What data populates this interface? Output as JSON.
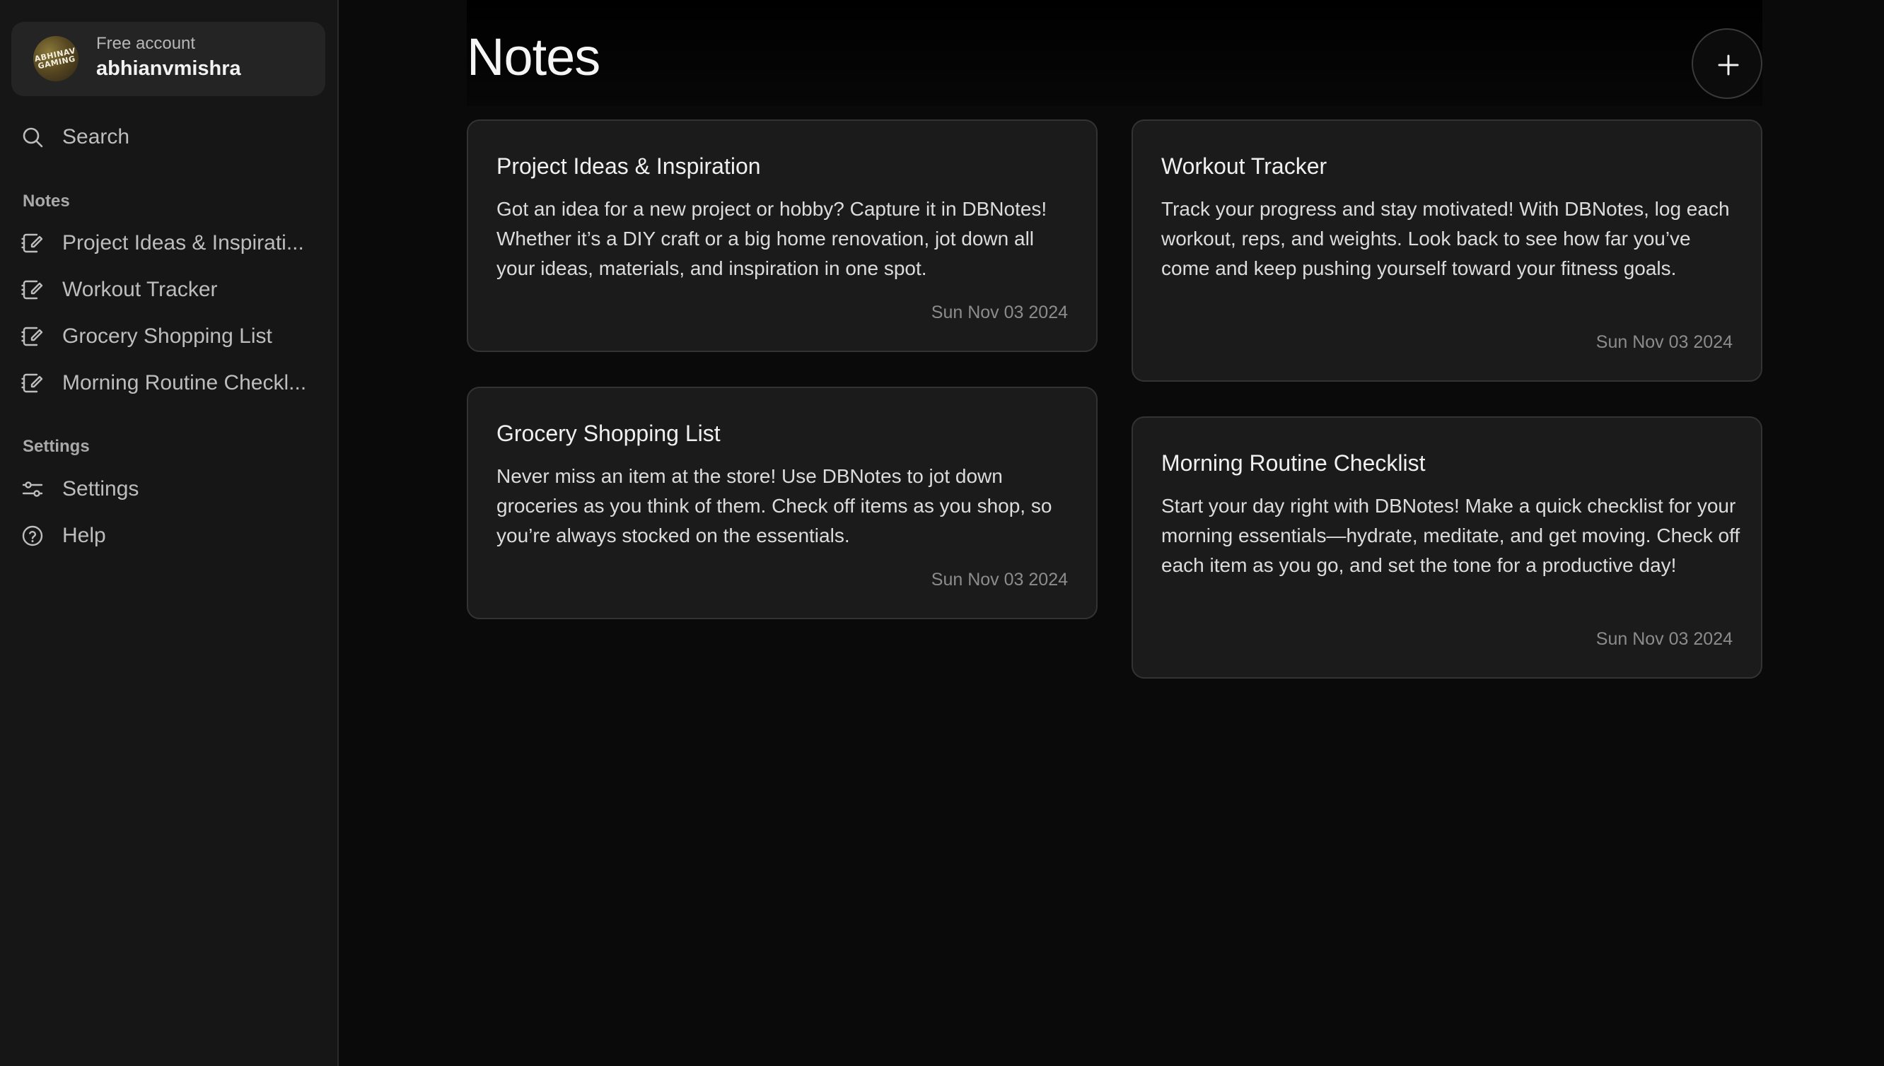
{
  "account": {
    "plan": "Free account",
    "username": "abhianvmishra",
    "avatar_text": "ABHINAV GAMING"
  },
  "sidebar": {
    "search_label": "Search",
    "notes_heading": "Notes",
    "notes": [
      {
        "label": "Project Ideas & Inspirati...",
        "icon": "edit-note-icon"
      },
      {
        "label": "Workout Tracker",
        "icon": "edit-note-icon"
      },
      {
        "label": "Grocery Shopping List",
        "icon": "edit-note-icon"
      },
      {
        "label": "Morning Routine Checkl...",
        "icon": "edit-note-icon"
      }
    ],
    "settings_heading": "Settings",
    "settings_items": [
      {
        "label": "Settings",
        "icon": "sliders-icon"
      },
      {
        "label": "Help",
        "icon": "help-circle-icon"
      }
    ]
  },
  "main": {
    "title": "Notes",
    "add_button_icon": "plus-icon",
    "cards": [
      {
        "title": "Project Ideas & Inspiration",
        "body": "Got an idea for a new project or hobby? Capture it in DBNotes! Whether it’s a DIY craft or a big home renovation, jot down all your ideas, materials, and inspiration in one spot.",
        "date": "Sun Nov 03 2024"
      },
      {
        "title": "Workout Tracker",
        "body": "Track your progress and stay motivated! With DBNotes, log each workout, reps, and weights. Look back to see how far you’ve come and keep pushing yourself toward your fitness goals.",
        "date": "Sun Nov 03 2024"
      },
      {
        "title": "Grocery Shopping List",
        "body": "Never miss an item at the store! Use DBNotes to jot down groceries as you think of them. Check off items as you shop, so you’re always stocked on the essentials.",
        "date": "Sun Nov 03 2024"
      },
      {
        "title": "Morning Routine Checklist",
        "body": "Start your day right with DBNotes! Make a quick checklist for your morning essentials—hydrate, meditate, and get moving. Check off each item as you go, and set the tone for a productive day!",
        "date": "Sun Nov 03 2024"
      }
    ]
  },
  "colors": {
    "background": "#0a0a0a",
    "sidebar": "#161616",
    "card": "#1b1b1b",
    "card_border": "#333333"
  }
}
